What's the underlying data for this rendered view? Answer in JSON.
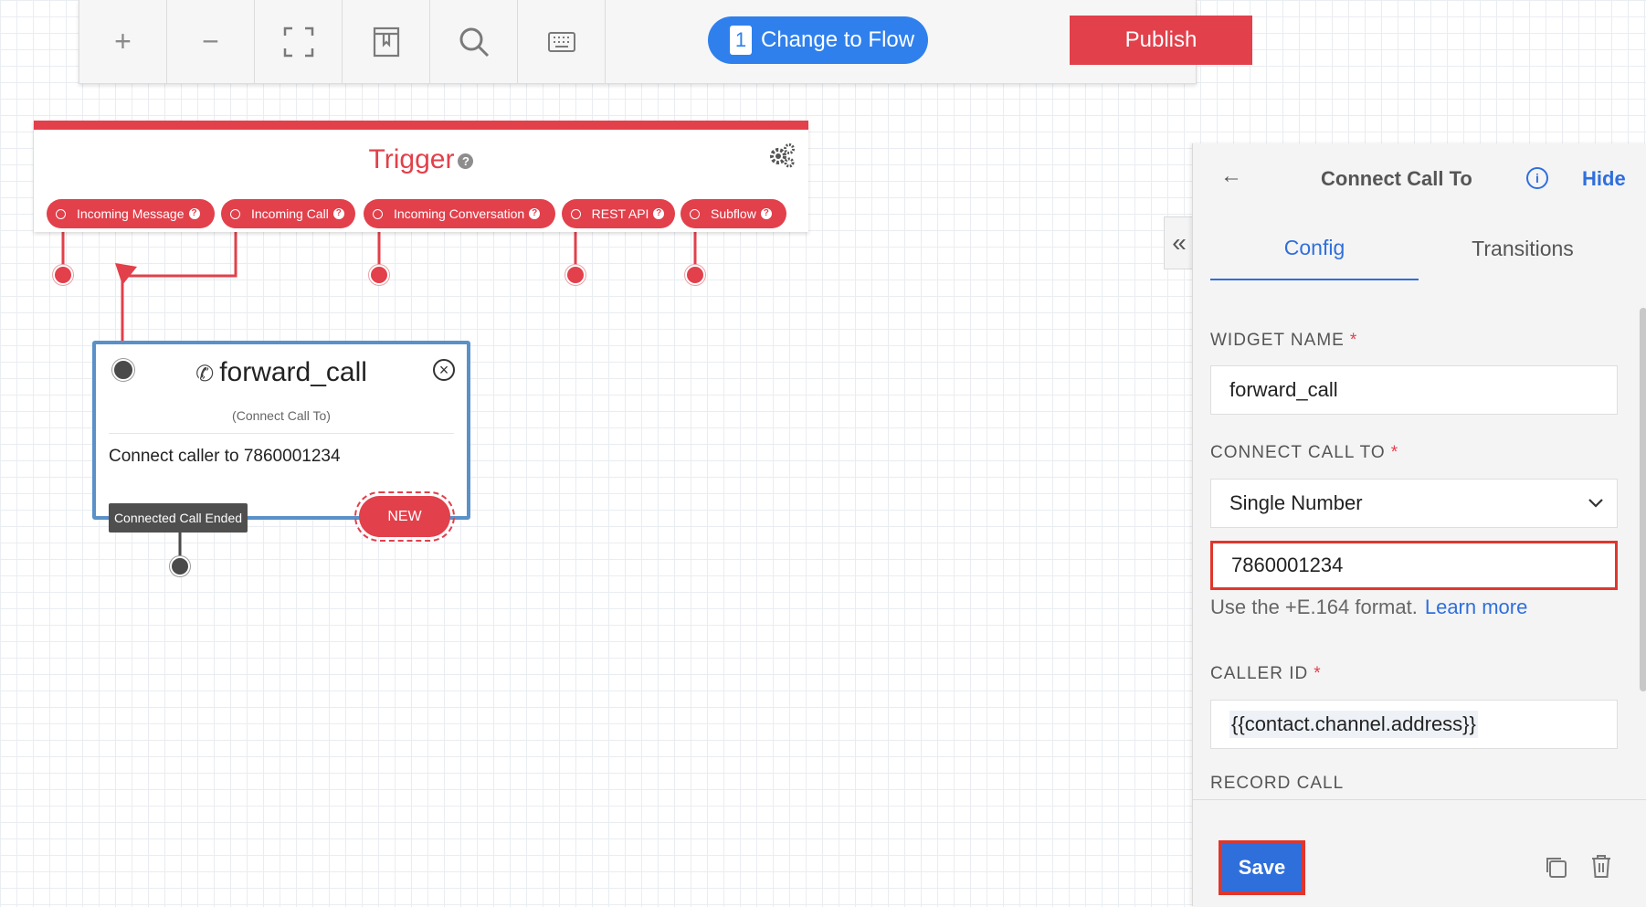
{
  "toolbar": {
    "tools": [
      {
        "name": "zoom-in-icon",
        "glyph": "+"
      },
      {
        "name": "zoom-out-icon",
        "glyph": "−"
      },
      {
        "name": "fit-screen-icon",
        "glyph": ""
      },
      {
        "name": "bookmark-icon",
        "glyph": ""
      },
      {
        "name": "search-icon",
        "glyph": ""
      },
      {
        "name": "keyboard-icon",
        "glyph": ""
      }
    ],
    "change_flow_badge": "1",
    "change_flow_label": "Change to Flow",
    "publish_label": "Publish"
  },
  "trigger": {
    "title": "Trigger",
    "help": "?",
    "pills": [
      {
        "label": "Incoming Message"
      },
      {
        "label": "Incoming Call"
      },
      {
        "label": "Incoming Conversation"
      },
      {
        "label": "REST API"
      },
      {
        "label": "Subflow"
      }
    ]
  },
  "widget": {
    "name": "forward_call",
    "type_label": "(Connect Call To)",
    "description": "Connect caller to 7860001234",
    "ended_label": "Connected Call Ended",
    "new_label": "NEW"
  },
  "panel": {
    "title": "Connect Call To",
    "hide_label": "Hide",
    "tabs": [
      {
        "label": "Config",
        "active": true
      },
      {
        "label": "Transitions",
        "active": false
      }
    ],
    "fields": {
      "widget_name_label": "WIDGET NAME",
      "widget_name_value": "forward_call",
      "connect_to_label": "CONNECT CALL TO",
      "connect_to_value": "Single Number",
      "number_value": "7860001234",
      "hint": "Use the +E.164 format.",
      "hint_link": "Learn more",
      "caller_id_label": "CALLER ID",
      "caller_id_value": "{{contact.channel.address}}",
      "record_call_label": "RECORD CALL"
    },
    "save_label": "Save"
  },
  "colors": {
    "accent_red": "#e2404b",
    "accent_blue": "#2f6fdc",
    "flow_blue": "#2f80ed",
    "highlight": "#e0362c"
  }
}
